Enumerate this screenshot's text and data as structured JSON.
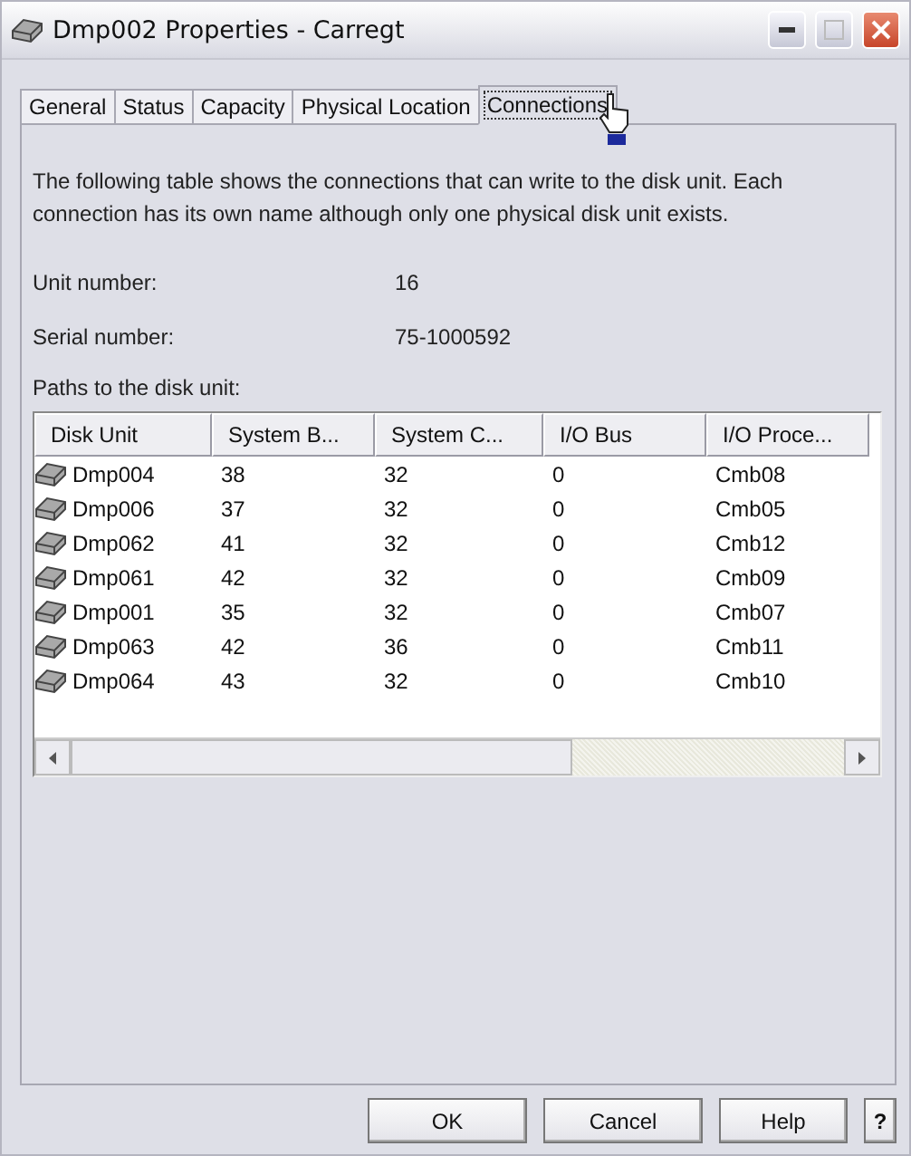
{
  "window": {
    "title": "Dmp002 Properties - Carregt"
  },
  "tabs": [
    {
      "label": "General",
      "selected": false
    },
    {
      "label": "Status",
      "selected": false
    },
    {
      "label": "Capacity",
      "selected": false
    },
    {
      "label": "Physical Location",
      "selected": false
    },
    {
      "label": "Connections",
      "selected": true
    }
  ],
  "description": "The following table shows the connections that can write to the disk unit.   Each connection has its own name although only one physical disk unit exists.",
  "fields": [
    {
      "label": "Unit number:",
      "value": "16"
    },
    {
      "label": "Serial number:",
      "value": "75-1000592"
    }
  ],
  "table": {
    "caption": "Paths to the disk unit:",
    "columns": [
      "Disk Unit",
      "System B...",
      "System C...",
      "I/O Bus",
      "I/O Proce..."
    ],
    "rows": [
      [
        "Dmp004",
        "38",
        "32",
        "0",
        "Cmb08"
      ],
      [
        "Dmp006",
        "37",
        "32",
        "0",
        "Cmb05"
      ],
      [
        "Dmp062",
        "41",
        "32",
        "0",
        "Cmb12"
      ],
      [
        "Dmp061",
        "42",
        "32",
        "0",
        "Cmb09"
      ],
      [
        "Dmp001",
        "35",
        "32",
        "0",
        "Cmb07"
      ],
      [
        "Dmp063",
        "42",
        "36",
        "0",
        "Cmb11"
      ],
      [
        "Dmp064",
        "43",
        "32",
        "0",
        "Cmb10"
      ]
    ]
  },
  "buttons": [
    {
      "label": "OK",
      "kind": "ok"
    },
    {
      "label": "Cancel",
      "kind": "cancel"
    },
    {
      "label": "Help",
      "kind": "help"
    },
    {
      "label": "?",
      "kind": "whats-this"
    }
  ]
}
